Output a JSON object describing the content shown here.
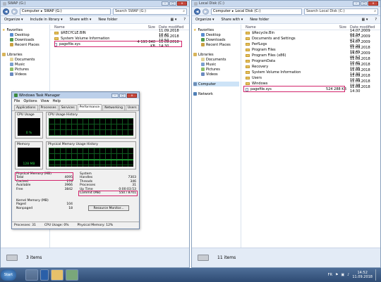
{
  "left_window": {
    "title": "SWAP (G:)",
    "back": "◀",
    "forward": "▶",
    "path": [
      "Computer",
      "SWAP (G:)"
    ],
    "search_placeholder": "Search SWAP (G:)",
    "commands": [
      "Organize ▾",
      "Include in library ▾",
      "Share with ▾",
      "New folder"
    ],
    "headers": {
      "name": "Name",
      "size": "Size",
      "date": "Date modified"
    },
    "files": [
      {
        "name": "$RECYCLE.BIN",
        "size": "",
        "date": "11.09.2018 10:4?",
        "kind": "folder"
      },
      {
        "name": "System Volume Information",
        "size": "",
        "date": "11.09.2018 10:50",
        "kind": "folder"
      },
      {
        "name": "pagefile.sys",
        "size": "4 193 848 KB",
        "date": "11.09.2018 14:30",
        "kind": "file"
      }
    ],
    "nav": {
      "favorites": "Favorites",
      "favorites_items": [
        "Desktop",
        "Downloads",
        "Recent Places"
      ],
      "libraries": "Libraries",
      "libraries_items": [
        "Documents",
        "Music",
        "Pictures",
        "Videos"
      ]
    },
    "status": "3 items"
  },
  "right_window": {
    "title": "Local Disk (C:)",
    "back": "◀",
    "forward": "▶",
    "path": [
      "Computer",
      "Local Disk (C:)"
    ],
    "search_placeholder": "Search Local Disk (C:)",
    "commands": [
      "Organize ▾",
      "Share with ▾",
      "New folder"
    ],
    "headers": {
      "name": "Name",
      "size": "Size",
      "date": "Date modified"
    },
    "files": [
      {
        "name": "$Recycle.Bin",
        "size": "",
        "date": "14.07.2009 04:34",
        "kind": "folder"
      },
      {
        "name": "Documents and Settings",
        "size": "",
        "date": "14.07.2009 07:25",
        "kind": "folder"
      },
      {
        "name": "PerfLogs",
        "size": "",
        "date": "14.07.2009 05:20",
        "kind": "folder"
      },
      {
        "name": "Program Files",
        "size": "",
        "date": "11.09.2018 10:41",
        "kind": "folder"
      },
      {
        "name": "Program Files (x86)",
        "size": "",
        "date": "14.07.2009 06:57",
        "kind": "folder"
      },
      {
        "name": "ProgramData",
        "size": "",
        "date": "11.09.2018 10:41",
        "kind": "folder"
      },
      {
        "name": "Recovery",
        "size": "",
        "date": "11.09.2018 10:35",
        "kind": "folder"
      },
      {
        "name": "System Volume Information",
        "size": "",
        "date": "11.09.2018 14:30",
        "kind": "folder"
      },
      {
        "name": "Users",
        "size": "",
        "date": "11.09.2018 10:35",
        "kind": "folder"
      },
      {
        "name": "Windows",
        "size": "",
        "date": "11.09.2018 10:38",
        "kind": "folder"
      },
      {
        "name": "pagefile.sys",
        "size": "524 288 KB",
        "date": "11.09.2018 14:30",
        "kind": "file"
      }
    ],
    "nav": {
      "favorites": "Favorites",
      "favorites_items": [
        "Desktop",
        "Downloads",
        "Recent Places"
      ],
      "libraries": "Libraries",
      "libraries_items": [
        "Documents",
        "Music",
        "Pictures",
        "Videos"
      ],
      "computer": "Computer",
      "network": "Network"
    },
    "status": "11 items"
  },
  "task_manager": {
    "title": "Windows Task Manager",
    "menu": [
      "File",
      "Options",
      "View",
      "Help"
    ],
    "tabs": [
      "Applications",
      "Processes",
      "Services",
      "Performance",
      "Networking",
      "Users"
    ],
    "active_tab": "Performance",
    "cpu_usage": "CPU Usage",
    "cpu_value": "0 %",
    "cpu_history": "CPU Usage History",
    "memory": "Memory",
    "memory_value": "128 MB",
    "mem_history": "Physical Memory Usage History",
    "physical_memory": "Physical Memory (MB)",
    "pm_rows": [
      {
        "k": "Total",
        "v": "4095"
      },
      {
        "k": "Cached",
        "v": "176"
      },
      {
        "k": "Available",
        "v": "3966"
      },
      {
        "k": "Free",
        "v": "3842"
      }
    ],
    "kernel_memory": "Kernel Memory (MB)",
    "km_rows": [
      {
        "k": "Paged",
        "v": "104"
      },
      {
        "k": "Nonpaged",
        "v": "18"
      }
    ],
    "system": "System",
    "sys_rows": [
      {
        "k": "Handles",
        "v": "7303"
      },
      {
        "k": "Threads",
        "v": "346"
      },
      {
        "k": "Processes",
        "v": "31"
      },
      {
        "k": "Up Time",
        "v": "0:00:03:53"
      }
    ],
    "commit": "Commit (MB)",
    "commit_value": "550 / 8701",
    "resource_monitor": "Resource Monitor...",
    "status_processes": "Processes: 31",
    "status_cpu": "CPU Usage: 0%",
    "status_mem": "Physical Memory: 12%"
  },
  "taskbar": {
    "start": "Start",
    "lang": "FR",
    "time": "14:52",
    "date": "11.09.2018"
  },
  "colors": {
    "highlight": "#d2236b",
    "graph_line": "#2ed34a"
  }
}
